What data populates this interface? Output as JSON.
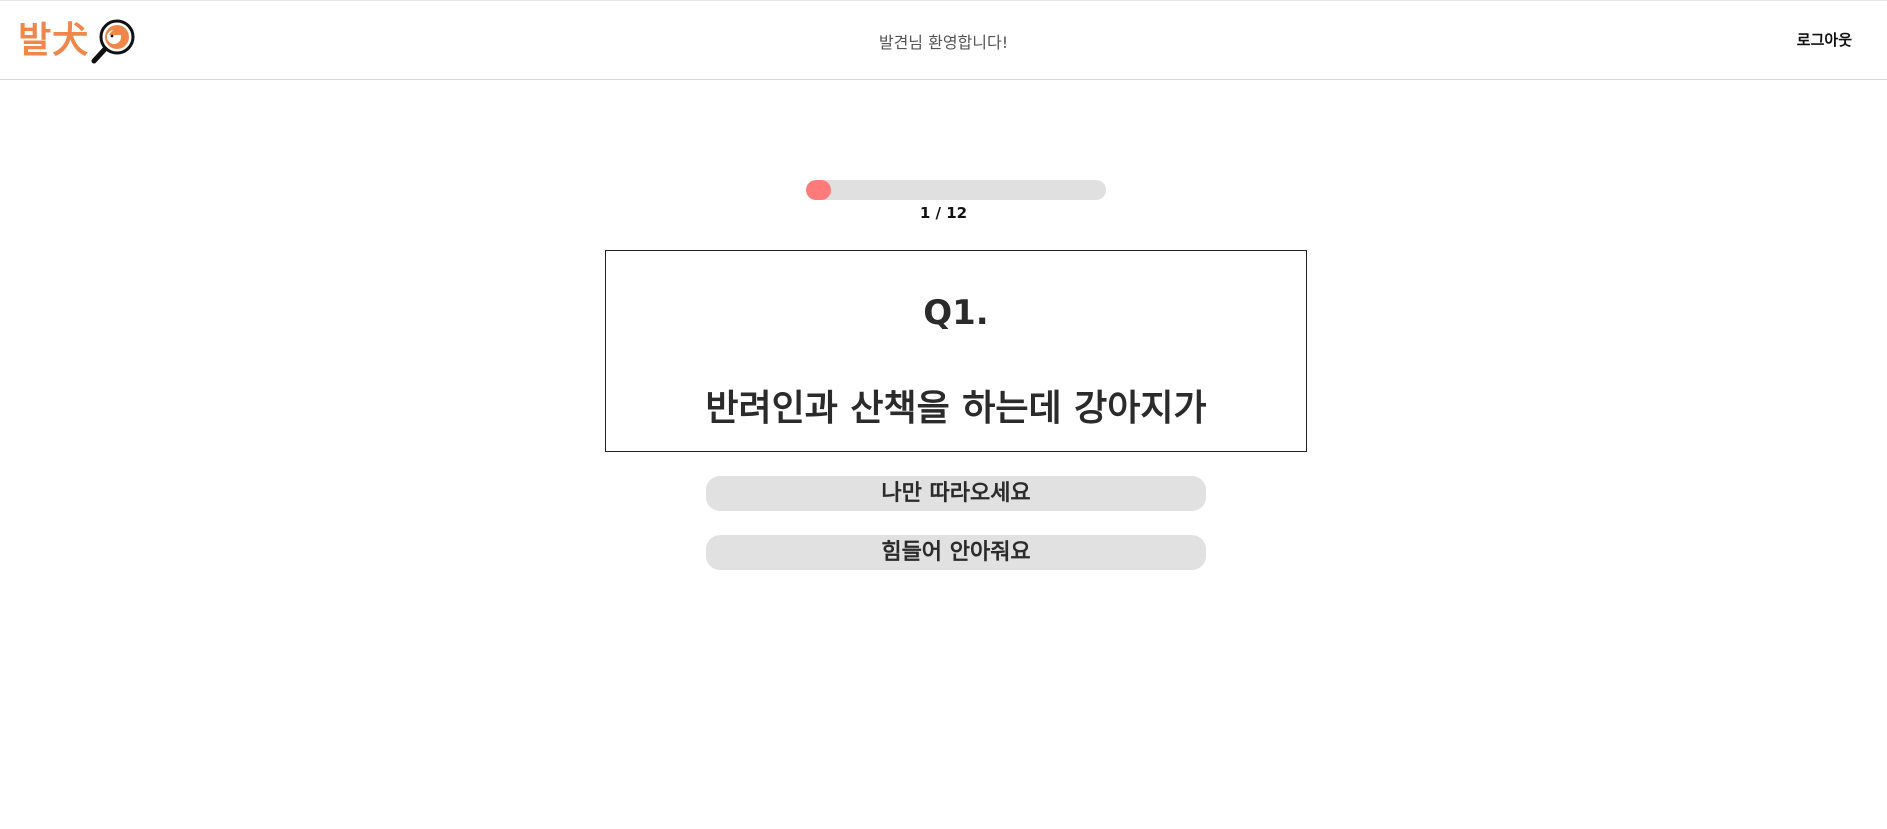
{
  "header": {
    "logo_text": "발犬",
    "logo_icon": "magnifier-dog-icon",
    "welcome_text": "발견님 환영합니다!",
    "logout_label": "로그아웃"
  },
  "progress": {
    "current": 1,
    "total": 12,
    "fraction": 0.0833,
    "label": "1 / 12",
    "fill_color": "#ff7b7b",
    "track_color": "#e0e0e0"
  },
  "question": {
    "number_label": "Q1.",
    "text": "반려인과 산책을 하는데 강아지가"
  },
  "answers": [
    {
      "label": "나만 따라오세요"
    },
    {
      "label": "힘들어 안아줘요"
    }
  ],
  "colors": {
    "brand": "#f0874a",
    "answer_bg": "#e1e1e1"
  }
}
